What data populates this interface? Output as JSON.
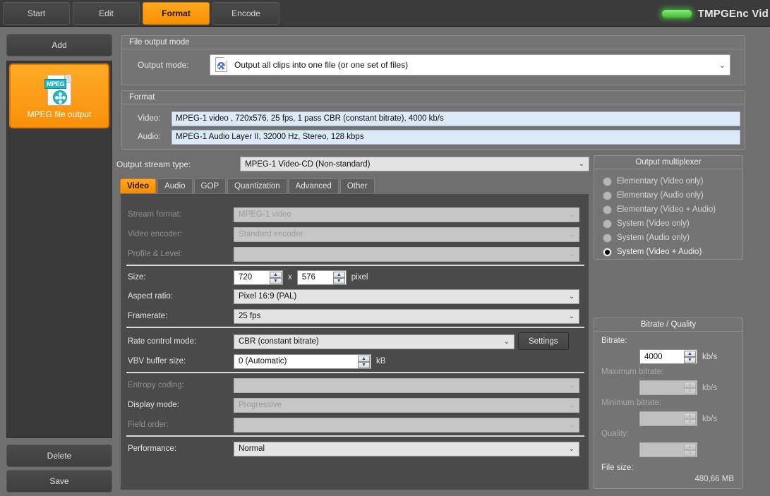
{
  "titlebar": {
    "app_title": "TMPGEnc Vid",
    "led_name": "status-led"
  },
  "topnav": {
    "tabs": [
      {
        "label": "Start",
        "active": false
      },
      {
        "label": "Edit",
        "active": false
      },
      {
        "label": "Format",
        "active": true
      },
      {
        "label": "Encode",
        "active": false
      }
    ]
  },
  "sidebar": {
    "add_label": "Add",
    "delete_label": "Delete",
    "save_label": "Save",
    "items": [
      {
        "label": "MPEG file output",
        "badge": "MPEG",
        "selected": true
      }
    ]
  },
  "file_output_mode": {
    "caption": "File output mode",
    "label": "Output mode:",
    "value": "Output all clips into one file (or one set of files)",
    "chevron": "⌄"
  },
  "format": {
    "caption": "Format",
    "rows": [
      {
        "label": "Video:",
        "value": "MPEG-1 video , 720x576, 25 fps, 1 pass CBR (constant bitrate), 4000 kb/s"
      },
      {
        "label": "Audio:",
        "value": "MPEG-1 Audio Layer II, 32000 Hz, Stereo, 128 kbps"
      }
    ]
  },
  "output_stream": {
    "label": "Output stream type:",
    "value": "MPEG-1 Video-CD (Non-standard)",
    "chevron": "⌄"
  },
  "tabs": [
    {
      "label": "Video",
      "active": true
    },
    {
      "label": "Audio",
      "active": false
    },
    {
      "label": "GOP",
      "active": false
    },
    {
      "label": "Quantization",
      "active": false
    },
    {
      "label": "Advanced",
      "active": false
    },
    {
      "label": "Other",
      "active": false
    }
  ],
  "video_panel": {
    "stream_format": {
      "label": "Stream format:",
      "value": "MPEG-1 video"
    },
    "video_encoder": {
      "label": "Video encoder:",
      "value": "Standard encoder"
    },
    "profile_level": {
      "label": "Profile & Level:",
      "value": ""
    },
    "size": {
      "label": "Size:",
      "width": "720",
      "height": "576",
      "x": "x",
      "unit": "pixel"
    },
    "aspect_ratio": {
      "label": "Aspect ratio:",
      "value": "Pixel 16:9 (PAL)"
    },
    "framerate": {
      "label": "Framerate:",
      "value": "25 fps"
    },
    "rate_control": {
      "label": "Rate control mode:",
      "value": "CBR (constant bitrate)",
      "settings_label": "Settings"
    },
    "vbv_buffer": {
      "label": "VBV buffer size:",
      "value": "0 (Automatic)",
      "unit": "kB"
    },
    "entropy_coding": {
      "label": "Entropy coding:",
      "value": ""
    },
    "display_mode": {
      "label": "Display mode:",
      "value": "Progressive"
    },
    "field_order": {
      "label": "Field order:",
      "value": ""
    },
    "performance": {
      "label": "Performance:",
      "value": "Normal"
    },
    "chevron": "⌄"
  },
  "multiplexer": {
    "caption": "Output multiplexer",
    "options": [
      {
        "label": "Elementary (Video only)",
        "selected": false
      },
      {
        "label": "Elementary (Audio only)",
        "selected": false
      },
      {
        "label": "Elementary (Video + Audio)",
        "selected": false
      },
      {
        "label": "System (Video only)",
        "selected": false
      },
      {
        "label": "System (Audio only)",
        "selected": false
      },
      {
        "label": "System (Video + Audio)",
        "selected": true
      }
    ]
  },
  "bitrate_quality": {
    "caption": "Bitrate / Quality",
    "bitrate": {
      "label": "Bitrate:",
      "value": "4000",
      "unit": "kb/s"
    },
    "maximum_bitrate": {
      "label": "Maximum bitrate:",
      "value": "",
      "unit": "kb/s"
    },
    "minimum_bitrate": {
      "label": "Minimum bitrate:",
      "value": "",
      "unit": "kb/s"
    },
    "quality": {
      "label": "Quality:",
      "value": ""
    },
    "file_size": {
      "label": "File size:",
      "value": "480,66 MB"
    }
  },
  "colors": {
    "accent": "#f8900a",
    "window_bg": "#6f6f6f",
    "panel_bg": "#4a4a4a",
    "group_bg": "#747474",
    "titlebar_bg": "#3b3b3b",
    "format_field_bg": "#dce9f7",
    "led_green": "#5adc50"
  }
}
